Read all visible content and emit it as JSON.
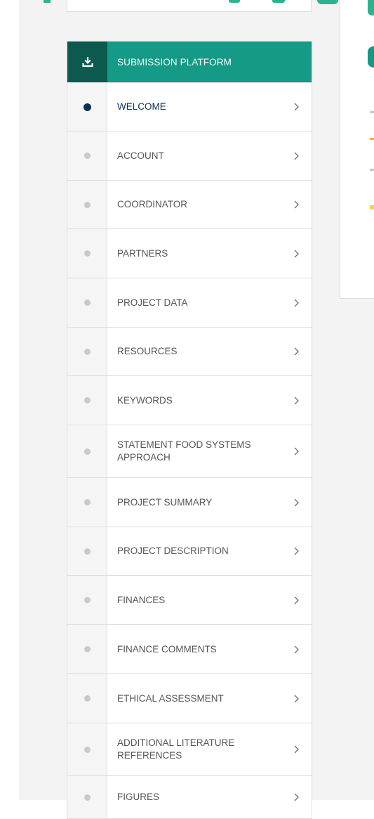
{
  "sidebar": {
    "header": {
      "title": "SUBMISSION PLATFORM",
      "icon": "download-icon",
      "header_color": "#149a86",
      "icon_cell_color": "#0b5a4d"
    },
    "items": [
      {
        "label": "WELCOME",
        "active": true,
        "height": 68
      },
      {
        "label": "ACCOUNT",
        "active": false,
        "height": 69
      },
      {
        "label": "COORDINATOR",
        "active": false,
        "height": 68
      },
      {
        "label": "PARTNERS",
        "active": false,
        "height": 69
      },
      {
        "label": "PROJECT DATA",
        "active": false,
        "height": 69
      },
      {
        "label": "RESOURCES",
        "active": false,
        "height": 68
      },
      {
        "label": "KEYWORDS",
        "active": false,
        "height": 69
      },
      {
        "label": "STATEMENT FOOD SYSTEMS APPROACH",
        "active": false,
        "height": 74
      },
      {
        "label": "PROJECT SUMMARY",
        "active": false,
        "height": 69
      },
      {
        "label": "PROJECT DESCRIPTION",
        "active": false,
        "height": 68
      },
      {
        "label": "FINANCES",
        "active": false,
        "height": 69
      },
      {
        "label": "FINANCE COMMENTS",
        "active": false,
        "height": 69
      },
      {
        "label": "ETHICAL ASSESSMENT",
        "active": false,
        "height": 69
      },
      {
        "label": "ADDITIONAL LITERATURE REFERENCES",
        "active": false,
        "height": 74
      },
      {
        "label": "FIGURES",
        "active": false,
        "height": 60
      }
    ],
    "active_dot_color": "#0f2f54",
    "inactive_dot_color": "#c9c9c9"
  }
}
